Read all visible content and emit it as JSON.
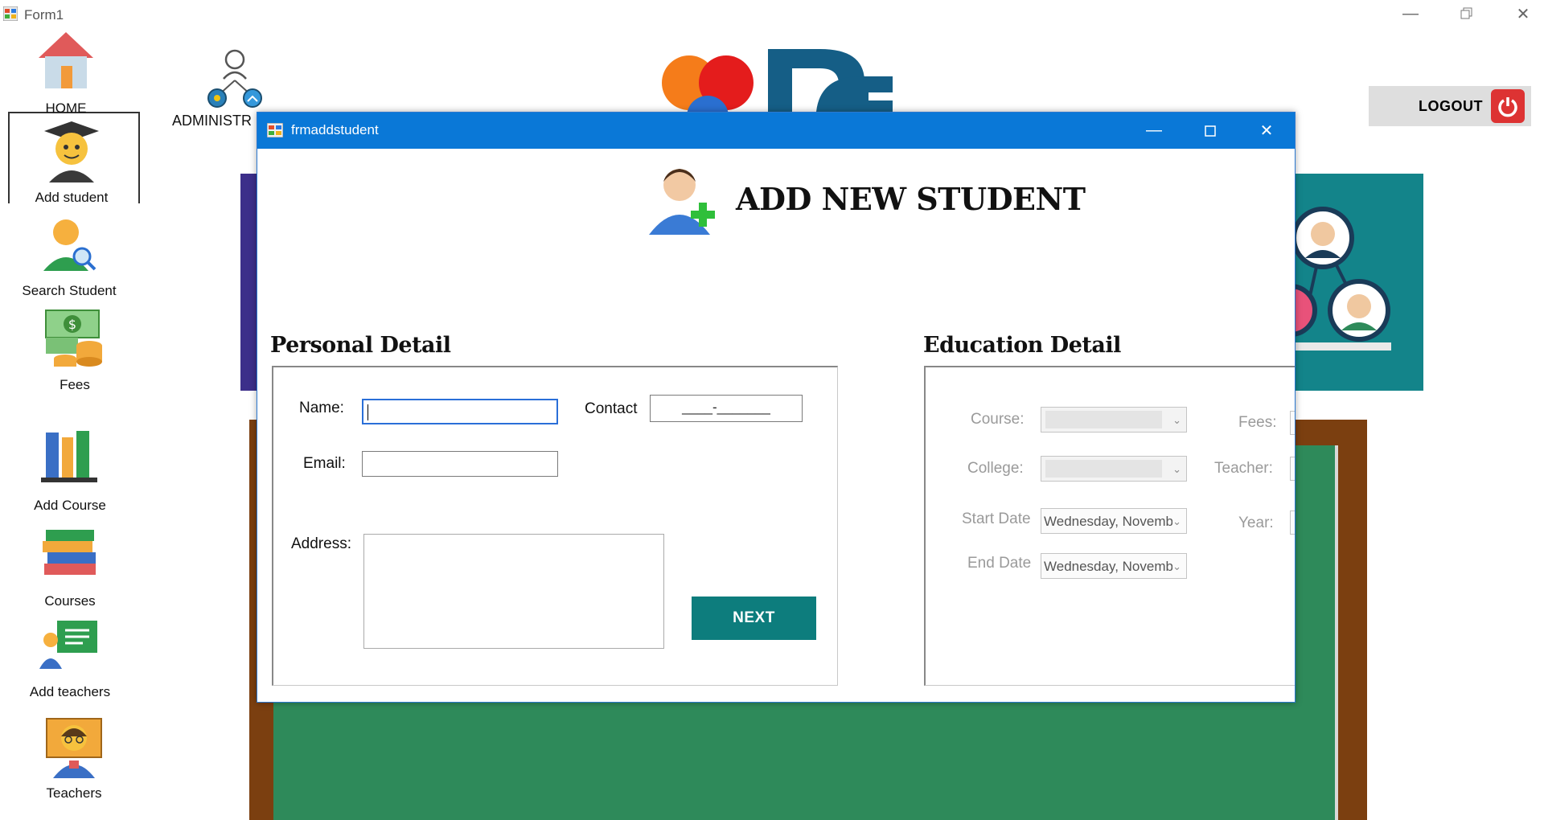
{
  "window": {
    "title": "Form1",
    "controls": [
      "minimize",
      "restore",
      "close"
    ]
  },
  "sidebar": {
    "items": [
      {
        "label": "HOME",
        "icon": "house-icon"
      },
      {
        "label": "Add student",
        "icon": "graduate-icon",
        "selected": true
      },
      {
        "label": "Search Student",
        "icon": "person-search-icon"
      },
      {
        "label": "Fees",
        "icon": "money-coins-icon"
      },
      {
        "label": "Add Course",
        "icon": "books-shelf-icon"
      },
      {
        "label": "Courses",
        "icon": "book-stack-icon"
      },
      {
        "label": "Add teachers",
        "icon": "blackboard-teacher-icon"
      },
      {
        "label": "Teachers",
        "icon": "teacher-icon"
      }
    ]
  },
  "admin": {
    "label": "ADMINISTR",
    "icon": "admin-network-icon"
  },
  "logout": {
    "label": "LOGOUT",
    "icon": "power-icon"
  },
  "dialog": {
    "title": "frmaddstudent",
    "heading": "ADD NEW STUDENT",
    "personal": {
      "title": "Personal Detail",
      "name_label": "Name:",
      "name_value": "",
      "contact_label": "Contact",
      "contact_mask": "____-_______",
      "email_label": "Email:",
      "email_value": "",
      "address_label": "Address:",
      "address_value": "",
      "next_label": "NEXT"
    },
    "education": {
      "title": "Education Detail",
      "course_label": "Course:",
      "course_value": "",
      "college_label": "College:",
      "college_value": "",
      "start_date_label": "Start Date",
      "start_date_value": "Wednesday, Novemb",
      "end_date_label": "End Date",
      "end_date_value": "Wednesday, Novemb",
      "fees_label": "Fees:",
      "teacher_label": "Teacher:",
      "year_label": "Year:"
    }
  },
  "colors": {
    "dialog_titlebar": "#0a78d7",
    "next_button": "#0d7d7d",
    "board_green": "#2e8a5a",
    "board_frame": "#7b3f10",
    "teal_panel": "#13848a",
    "logout_red": "#d33333"
  }
}
